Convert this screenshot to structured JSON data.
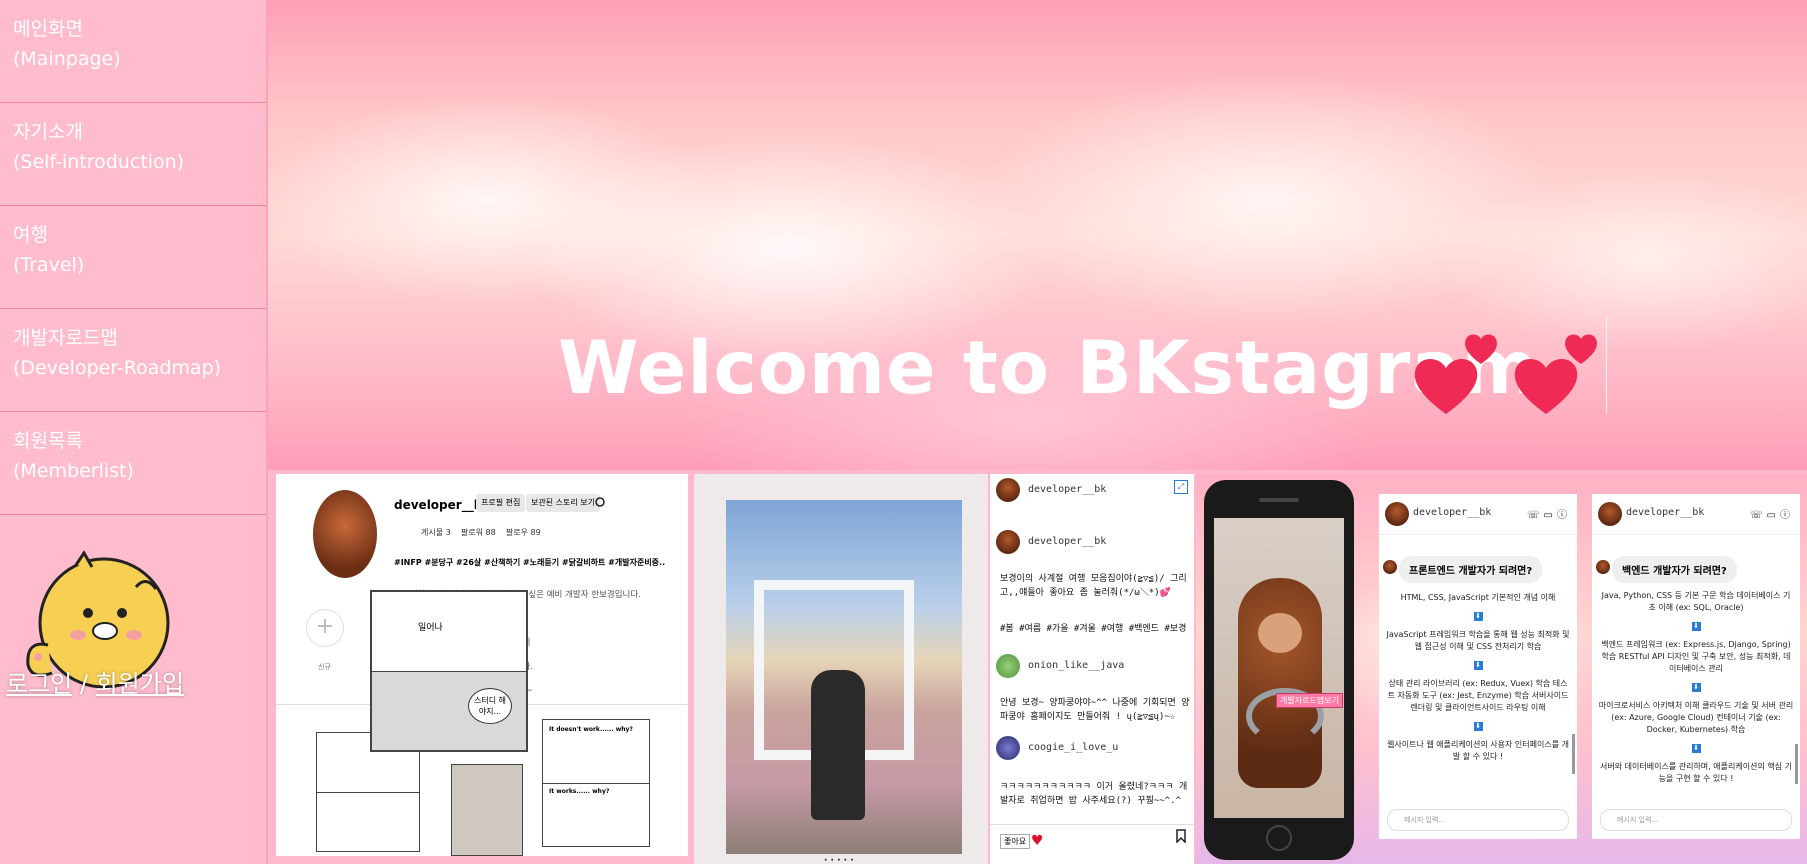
{
  "sidebar": {
    "items": [
      {
        "ko": "메인화면",
        "en": "(Mainpage)"
      },
      {
        "ko": "자기소개",
        "en": "(Self-introduction)"
      },
      {
        "ko": "여행",
        "en": "(Travel)"
      },
      {
        "ko": "개발자로드맵",
        "en": "(Developer-Roadmap)"
      },
      {
        "ko": "회원목록",
        "en": "(Memberlist)"
      }
    ],
    "login": "로그인",
    "separator": " / ",
    "signup": "회원가입"
  },
  "hero": {
    "title": "Welcome to BKstagram"
  },
  "colors": {
    "sidebar_bg": "#ffbccd",
    "heart": "#ee2a55",
    "accent_blue": "#2a7bd4"
  },
  "profile": {
    "username": "developer__bk",
    "edit_button": "프로필 편집",
    "archive_button": "보관된 스토리 보기",
    "posts": "게시물 3",
    "followers": "팔로워 88",
    "following": "팔로우 89",
    "tags": "#INFP #분당구 #26살 #산책하기 #노래듣기 #닭갈비하트 #개발자준비중..",
    "bio": "안녕하세요 ! 백엔드 개발자가 되고 싶은 예비 개발자 한보경입니다.\n...이 도전하는 과정 중에 있습니다.\n...을 충실히 하나씩 끝까지 포기하지\n...향해 한 걸음씩 나아가고자 합니다.\n... 나아가보겠습니다.. 감사합니다 ~",
    "new_label": "신규",
    "comic_texts": [
      "일어나",
      "스터디 해야지...",
      "It doesn't work...... why?",
      "It works...... why?"
    ]
  },
  "post": {
    "header_user": "developer__bk",
    "author": "developer__bk",
    "caption": "보경이의 사계절 여행 모음집이야(≧▽≦)/ 그리고,,얘들아 좋아요 좀 눌러줘(*/ω＼*)💕",
    "hashtags": "#봄 #여름 #가을 #겨울 #여행 #백엔드 #보경",
    "comments": [
      {
        "user": "onion_like__java",
        "text": "안녕 보경~ 양파쿵야야~^^ 나중에 기회되면 양파쿵야 홈페이지도 만들어줘 ! ų(≧▽≦ų)~☆"
      },
      {
        "user": "coogie_i_love_u",
        "text": "ㅋㅋㅋㅋㅋㅋㅋㅋㅋㅋㅋ 이거 올렸네?ㅋㅋㅋ 개발자로 취업하면 밥 사주세요(?) 꾸붱~~^.^"
      }
    ],
    "like_label": "좋아요"
  },
  "phone": {
    "tag": "개발자로드맵보기"
  },
  "chats": [
    {
      "user": "developer__bk",
      "question": "프론트엔드 개발자가 되려면?",
      "steps": [
        "HTML, CSS, JavaScript 기본적인 개념 이해",
        "JavaScript 프레임워크 학습을 통해 웹 성능 최적화 및 웹 접근성 이해 및 CSS 전처리기 학습",
        "상태 관리 라이브러리 (ex: Redux, Vuex) 학습 테스트 자동화 도구 (ex: Jest, Enzyme) 학습 서버사이드 렌더링 및 클라이언트사이드 라우팅 이해",
        "웹사이트나 웹 애플리케이션의 사용자 인터페이스를 개발 할 수 있다 !"
      ],
      "input_placeholder": "메시지 입력..."
    },
    {
      "user": "developer__bk",
      "question": "백엔드 개발자가 되려면?",
      "steps": [
        "Java, Python, CSS 등 기본 구문 학습 데이터베이스 기초 이해 (ex: SQL, Oracle)",
        "백엔드 프레임워크 (ex: Express.js, Django, Spring) 학습 RESTful API 디자인 및 구축 보안, 성능 최적화, 데이터베이스 관리",
        "마이크로서비스 아키텍처 이해 클라우드 기술 및 서버 관리 (ex: Azure, Google Cloud) 컨테이너 기술 (ex: Docker, Kubernetes) 학습",
        "서버와 데이터베이스를 관리하며, 애플리케이션의 핵심 기능을 구현 할 수 있다 !"
      ],
      "input_placeholder": "메시지 입력..."
    }
  ]
}
